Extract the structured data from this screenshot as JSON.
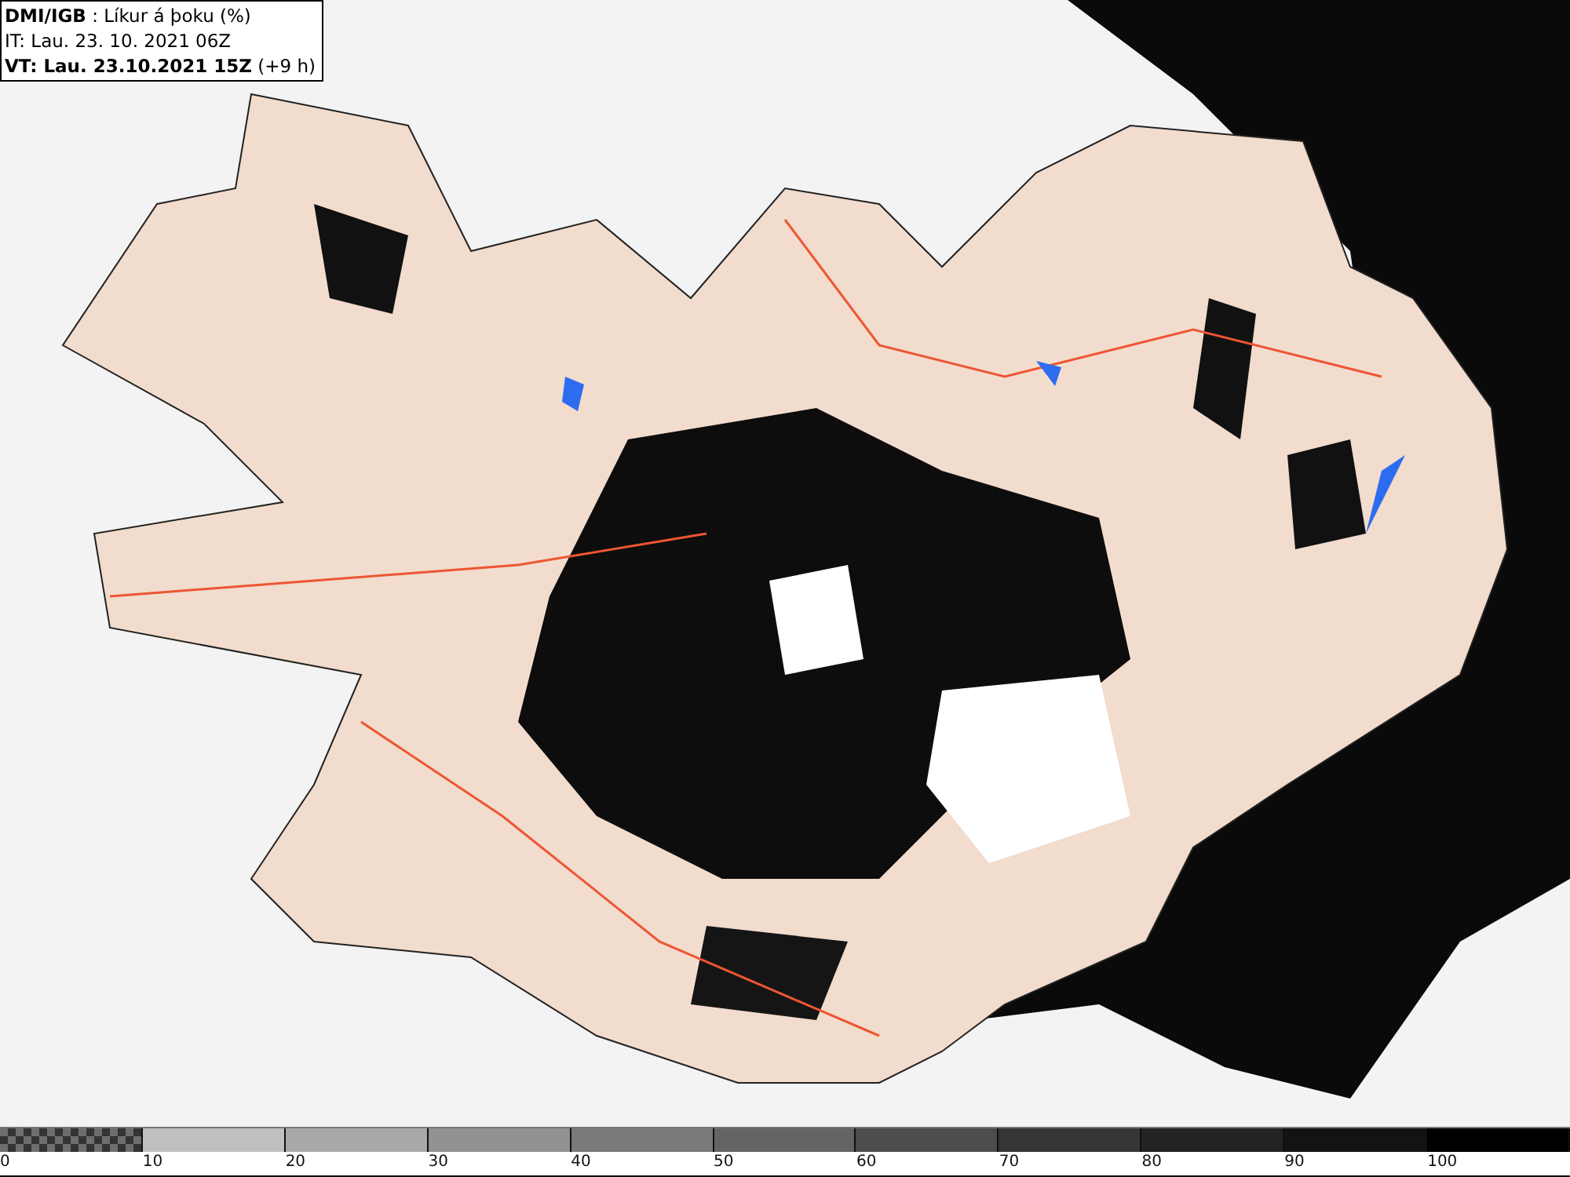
{
  "header": {
    "lines": [
      "**DMI/IGB** : Líkur á þoku (%)",
      "IT: Lau. 23. 10. 2021 06Z",
      "**VT: Lau. 23.10.2021 15Z** (+9 h)"
    ]
  },
  "legend": {
    "segments": [
      {
        "kind": "checker",
        "color": "#6e6e6e",
        "label": "0"
      },
      {
        "kind": "solid",
        "color": "#c0c0c0",
        "label": "10"
      },
      {
        "kind": "solid",
        "color": "#a9a9a9",
        "label": "20"
      },
      {
        "kind": "solid",
        "color": "#929292",
        "label": "30"
      },
      {
        "kind": "solid",
        "color": "#7a7a7a",
        "label": "40"
      },
      {
        "kind": "solid",
        "color": "#646464",
        "label": "50"
      },
      {
        "kind": "solid",
        "color": "#4d4d4d",
        "label": "60"
      },
      {
        "kind": "solid",
        "color": "#363636",
        "label": "70"
      },
      {
        "kind": "solid",
        "color": "#232323",
        "label": "80"
      },
      {
        "kind": "solid",
        "color": "#131313",
        "label": "90"
      },
      {
        "kind": "solid",
        "color": "#000000",
        "label": "100"
      }
    ]
  }
}
